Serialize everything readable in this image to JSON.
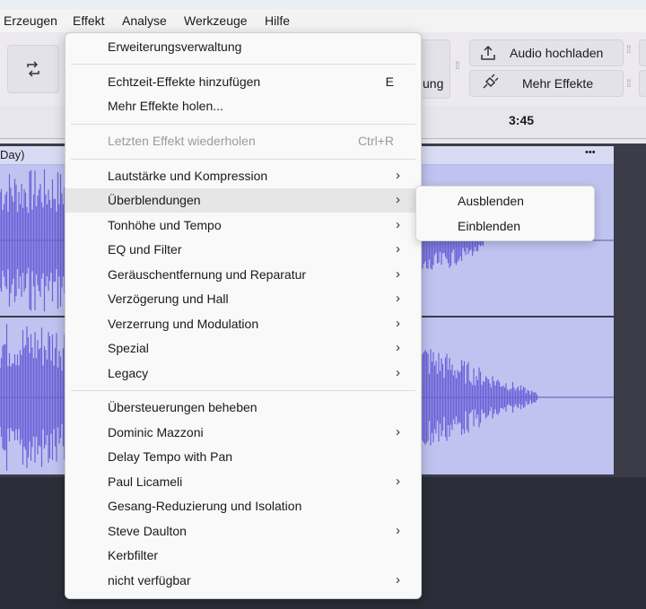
{
  "menubar": {
    "items": [
      "Erzeugen",
      "Effekt",
      "Analyse",
      "Werkzeuge",
      "Hilfe"
    ]
  },
  "toolbar": {
    "upload_label": "Audio hochladen",
    "more_effects_label": "Mehr Effekte",
    "partial_label": "ung"
  },
  "ruler": {
    "time_label": "3:45"
  },
  "track": {
    "name_fragment": "Day)",
    "menu_dots": "•••"
  },
  "effect_menu": {
    "items": [
      {
        "label": "Erweiterungsverwaltung",
        "shortcut": ""
      },
      {
        "label": "Echtzeit-Effekte hinzufügen",
        "shortcut": "E"
      },
      {
        "label": "Mehr Effekte holen...",
        "shortcut": ""
      },
      {
        "label": "Letzten Effekt wiederholen",
        "shortcut": "Ctrl+R"
      },
      {
        "label": "Lautstärke und Kompression",
        "shortcut": ""
      },
      {
        "label": "Überblendungen",
        "shortcut": ""
      },
      {
        "label": "Tonhöhe und Tempo",
        "shortcut": ""
      },
      {
        "label": "EQ und Filter",
        "shortcut": ""
      },
      {
        "label": "Geräuschentfernung und Reparatur",
        "shortcut": ""
      },
      {
        "label": "Verzögerung und Hall",
        "shortcut": ""
      },
      {
        "label": "Verzerrung und Modulation",
        "shortcut": ""
      },
      {
        "label": "Spezial",
        "shortcut": ""
      },
      {
        "label": "Legacy",
        "shortcut": ""
      },
      {
        "label": "Übersteuerungen beheben",
        "shortcut": ""
      },
      {
        "label": "Dominic Mazzoni",
        "shortcut": ""
      },
      {
        "label": "Delay Tempo with Pan",
        "shortcut": ""
      },
      {
        "label": "Paul Licameli",
        "shortcut": ""
      },
      {
        "label": "Gesang-Reduzierung und Isolation",
        "shortcut": ""
      },
      {
        "label": "Steve Daulton",
        "shortcut": ""
      },
      {
        "label": "Kerbfilter",
        "shortcut": ""
      },
      {
        "label": "nicht verfügbar",
        "shortcut": ""
      }
    ]
  },
  "submenu": {
    "items": [
      "Ausblenden",
      "Einblenden"
    ]
  },
  "colors": {
    "waveform": "#6a62d8",
    "clip_bg": "#c0c3f0",
    "track_bg": "#3b3c48"
  }
}
